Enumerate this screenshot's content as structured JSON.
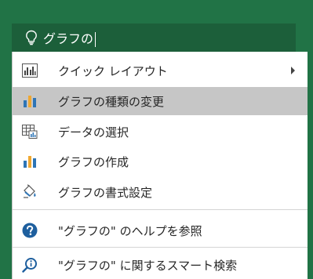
{
  "search": {
    "query": "グラフの"
  },
  "menu": {
    "items": [
      {
        "label": "クイック レイアウト",
        "icon": "quick-layout-icon",
        "has_submenu": true
      },
      {
        "label": "グラフの種類の変更",
        "icon": "change-chart-type-icon",
        "selected": true
      },
      {
        "label": "データの選択",
        "icon": "select-data-icon"
      },
      {
        "label": "グラフの作成",
        "icon": "create-chart-icon"
      },
      {
        "label": "グラフの書式設定",
        "icon": "format-chart-icon"
      },
      {
        "label": "\"グラフの\" のヘルプを参照",
        "icon": "help-icon"
      },
      {
        "label": "\"グラフの\" に関するスマート検索",
        "icon": "smart-lookup-icon"
      }
    ]
  },
  "colors": {
    "ribbon_green": "#217346",
    "search_bg": "#1c5f3a",
    "selected_bg": "#c6c6c6",
    "bar_blue": "#2e75b6",
    "bar_orange": "#f0a830",
    "help_blue": "#1e5f9e"
  }
}
